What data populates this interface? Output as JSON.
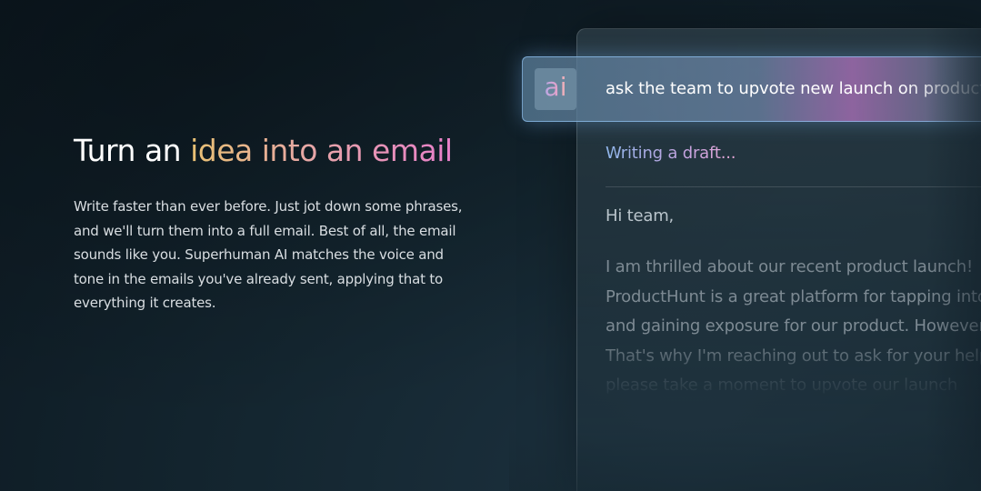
{
  "hero": {
    "title_prefix": "Turn an ",
    "title_highlight": "idea into an email",
    "description": "Write faster than ever before. Just jot down some phrases, and we'll turn them into a full email. Best of all, the email sounds like you. Superhuman AI matches the voice and tone in the emails you've already sent, applying that to everything it creates."
  },
  "prompt": {
    "badge": "ai",
    "text": "ask the team to upvote new launch on productHunt"
  },
  "draft": {
    "status": "Writing a draft...",
    "greeting": "Hi team,",
    "lines": [
      "I am thrilled about our recent product launch!",
      "ProductHunt is a great platform for tapping into",
      "and gaining exposure for our product. However",
      "That's why I'm reaching out to ask for your help",
      "please take a moment to upvote our launch"
    ]
  },
  "colors": {
    "gradient_start": "#e8c173",
    "gradient_end": "#e77fc9",
    "prompt_border": "#96cdff"
  },
  "icons": {
    "ai_badge": "ai-badge-icon"
  }
}
